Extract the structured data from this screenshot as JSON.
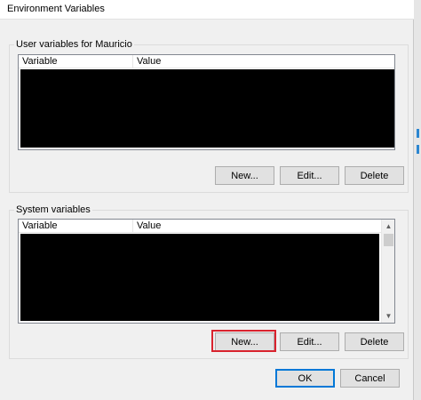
{
  "window": {
    "title": "Environment Variables"
  },
  "user_section": {
    "label": "User variables for Mauricio",
    "columns": [
      "Variable",
      "Value"
    ],
    "buttons": {
      "new": "New...",
      "edit": "Edit...",
      "delete": "Delete"
    }
  },
  "system_section": {
    "label": "System variables",
    "columns": [
      "Variable",
      "Value"
    ],
    "buttons": {
      "new": "New...",
      "edit": "Edit...",
      "delete": "Delete"
    }
  },
  "dialog_buttons": {
    "ok": "OK",
    "cancel": "Cancel"
  },
  "colors": {
    "highlight": "#d9232e",
    "accent": "#0078d7"
  },
  "icons": {
    "scroll_up": "scroll-up-arrow",
    "scroll_down": "scroll-down-arrow"
  }
}
